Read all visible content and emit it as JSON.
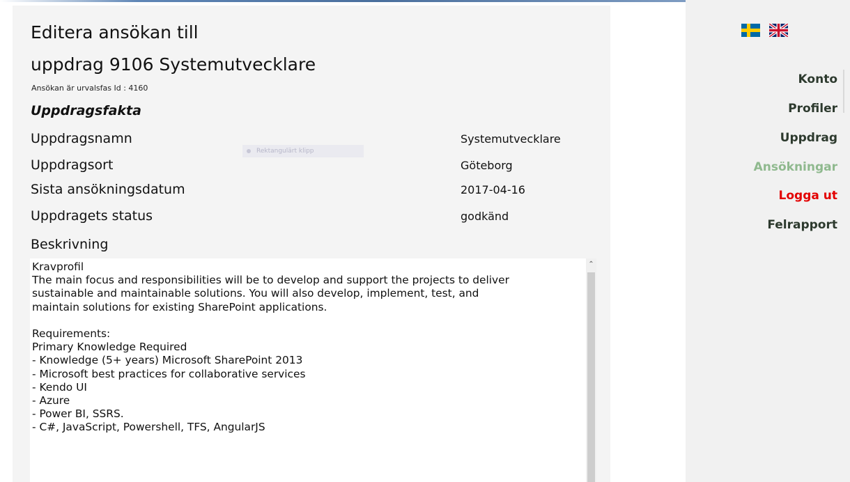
{
  "page": {
    "title_line1": "Editera ansökan till",
    "title_line2": "uppdrag 9106 Systemutvecklare",
    "subtitle": "Ansökan är urvalsfas   Id : 4160",
    "section_heading": "Uppdragsfakta",
    "facts": [
      {
        "label": "Uppdragsnamn",
        "value": "Systemutvecklare"
      },
      {
        "label": "Uppdragsort",
        "value": "Göteborg"
      },
      {
        "label": "Sista ansökningsdatum",
        "value": "2017-04-16"
      },
      {
        "label": "Uppdragets status",
        "value": "godkänd"
      }
    ],
    "description_label": "Beskrivning",
    "description_text": "Kravprofil\nThe main focus and responsibilities will be to develop and support the projects to deliver\nsustainable and maintainable solutions. You will also develop, implement, test, and\nmaintain solutions for existing SharePoint applications.\n\nRequirements:\nPrimary Knowledge Required\n- Knowledge (5+ years) Microsoft SharePoint 2013\n- Microsoft best practices for collaborative services\n- Kendo UI\n- Azure\n- Power BI, SSRS.\n- C#, JavaScript, Powershell, TFS, AngularJS",
    "ghost_overlay": "Rektangulärt klipp"
  },
  "sidebar": {
    "languages": [
      {
        "name": "swedish-flag",
        "colors": {
          "blue": "#006aa7",
          "yellow": "#fecc00"
        }
      },
      {
        "name": "uk-flag",
        "colors": {
          "blue": "#012169",
          "red": "#c8102e",
          "white": "#ffffff"
        }
      }
    ],
    "nav": [
      {
        "label": "Konto",
        "state": "normal"
      },
      {
        "label": "Profiler",
        "state": "normal"
      },
      {
        "label": "Uppdrag",
        "state": "normal"
      },
      {
        "label": "Ansökningar",
        "state": "active"
      },
      {
        "label": "Logga ut",
        "state": "logout"
      },
      {
        "label": "Felrapport",
        "state": "normal"
      }
    ]
  },
  "colors": {
    "nav_text": "#2d3a2e",
    "nav_active": "#8fb98e",
    "logout": "#e30000",
    "panel_bg": "#f4f4f4",
    "sidebar_bg": "#f1f1f1"
  }
}
